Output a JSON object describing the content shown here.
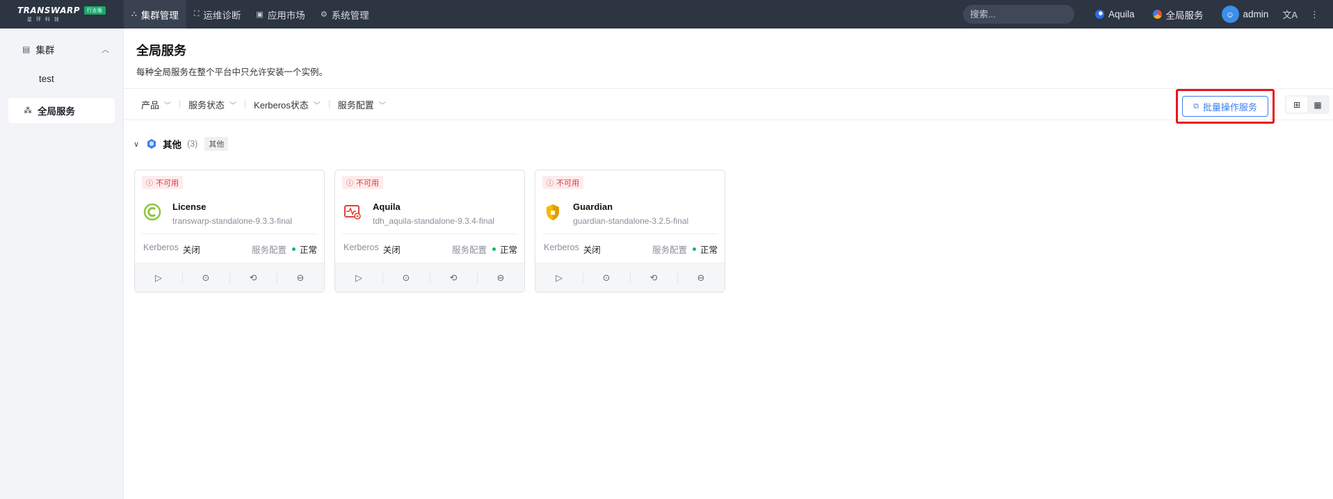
{
  "topbar": {
    "logo": {
      "brand": "TRANSWARP",
      "tag": "行业版",
      "sub": "星环科技"
    },
    "nav": [
      {
        "label": "集群管理",
        "icon": "cluster-icon",
        "active": true
      },
      {
        "label": "运维诊断",
        "icon": "diagnose-icon",
        "active": false
      },
      {
        "label": "应用市场",
        "icon": "market-icon",
        "active": false
      },
      {
        "label": "系统管理",
        "icon": "gear-icon",
        "active": false
      }
    ],
    "search_placeholder": "搜索...",
    "aquila_label": "Aquila",
    "global_services_label": "全局服务",
    "user_name": "admin"
  },
  "sidebar": {
    "group_label": "集群",
    "items": [
      {
        "label": "test"
      },
      {
        "label": "全局服务"
      }
    ]
  },
  "main": {
    "title": "全局服务",
    "description": "每种全局服务在整个平台中只允许安装一个实例。",
    "filters": [
      "产品",
      "服务状态",
      "Kerberos状态",
      "服务配置"
    ],
    "batch_button": "批量操作服务",
    "group": {
      "name": "其他",
      "count": "(3)",
      "tag": "其他"
    },
    "cards": [
      {
        "status": "不可用",
        "name": "License",
        "version": "transwarp-standalone-9.3.3-final",
        "kerberos_label": "Kerberos",
        "kerberos_value": "关闭",
        "config_label": "服务配置",
        "config_value": "正常",
        "icon": "license-icon"
      },
      {
        "status": "不可用",
        "name": "Aquila",
        "version": "tdh_aquila-standalone-9.3.4-final",
        "kerberos_label": "Kerberos",
        "kerberos_value": "关闭",
        "config_label": "服务配置",
        "config_value": "正常",
        "icon": "monitor-icon"
      },
      {
        "status": "不可用",
        "name": "Guardian",
        "version": "guardian-standalone-3.2.5-final",
        "kerberos_label": "Kerberos",
        "kerberos_value": "关闭",
        "config_label": "服务配置",
        "config_value": "正常",
        "icon": "shield-icon"
      }
    ]
  },
  "colors": {
    "topbar_bg": "#2d3442",
    "accent_blue": "#3d7df0",
    "status_red": "#d9363e",
    "status_green": "#1bb36a",
    "highlight_box": "#e8151a"
  }
}
